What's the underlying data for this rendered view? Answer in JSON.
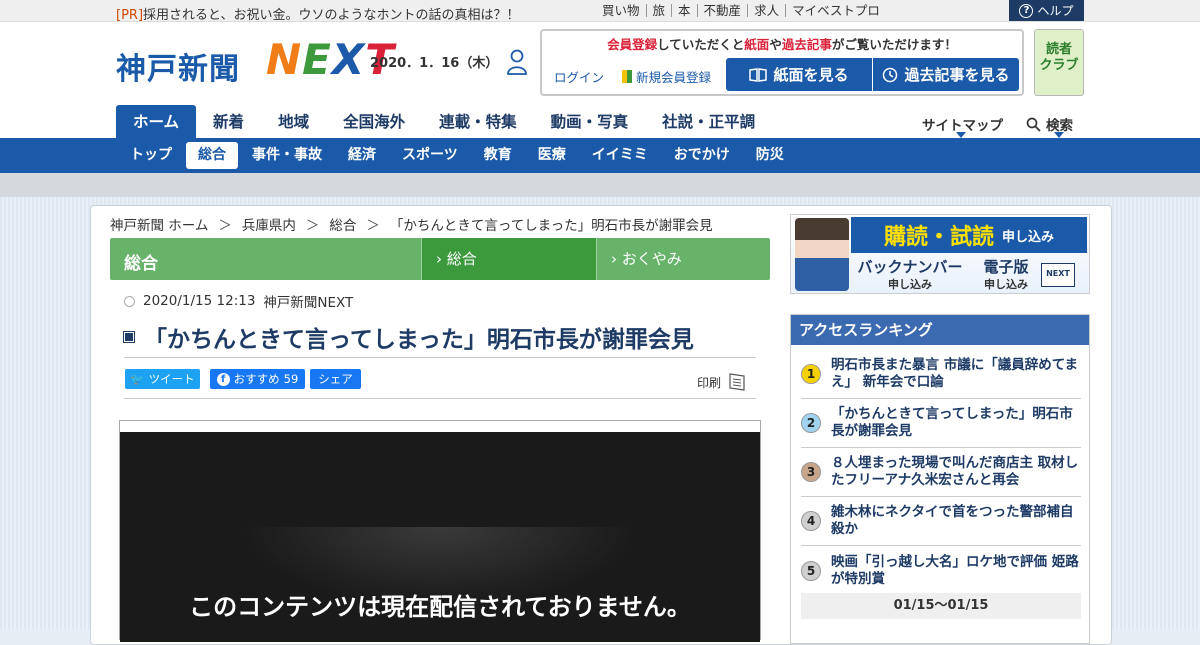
{
  "topbar": {
    "pr_tag": "[PR]",
    "pr_text": "採用されると、お祝い金。ウソのようなホントの話の真相は？！",
    "links": [
      "買い物",
      "旅",
      "本",
      "不動産",
      "求人",
      "マイベストプロ"
    ],
    "help": "ヘルプ"
  },
  "header": {
    "logo_jp": "神戸新聞",
    "logo_next": [
      "N",
      "E",
      "X",
      "T"
    ],
    "date": "2020．1．16（木）",
    "member_msg": {
      "p1": "会員登録",
      "p2": "していただくと",
      "p3": "紙面",
      "p4": "や",
      "p5": "過去記事",
      "p6": "がご覧いただけます！"
    },
    "login": "ログイン",
    "new_register": "新規会員登録",
    "paper_button": "紙面を見る",
    "past_button": "過去記事を見る",
    "reader_club_1": "読者",
    "reader_club_2": "クラブ"
  },
  "mainnav": {
    "items": [
      "ホーム",
      "新着",
      "地域",
      "全国海外",
      "連載・特集",
      "動画・写真",
      "社説・正平調"
    ],
    "sitemap": "サイトマップ",
    "search": "検索"
  },
  "subnav": {
    "items": [
      "トップ",
      "総合",
      "事件・事故",
      "経済",
      "スポーツ",
      "教育",
      "医療",
      "イイミミ",
      "おでかけ",
      "防災"
    ]
  },
  "breadcrumb": [
    "神戸新聞 ホーム",
    "兵庫県内",
    "総合",
    "「かちんときて言ってしまった」明石市長が謝罪会見"
  ],
  "category": {
    "title": "総合",
    "tab1": "総合",
    "tab2": "おくやみ"
  },
  "article": {
    "datetime": "2020/1/15 12:13",
    "source": "神戸新聞NEXT",
    "headline": "「かちんときて言ってしまった」明石市長が謝罪会見",
    "tweet": "ツイート",
    "fb_like": "おすすめ",
    "fb_like_count": "59",
    "fb_share": "シェア",
    "print": "印刷",
    "video_message": "このコンテンツは現在配信されておりません。"
  },
  "ad": {
    "subscribe": "購読・試読",
    "subscribe_small": "申し込み",
    "backnumber": "バックナンバー",
    "backnumber_small": "申し込み",
    "digital": "電子版",
    "digital_small": "申し込み",
    "next_badge": "NEXT"
  },
  "ranking": {
    "title": "アクセスランキング",
    "items": [
      {
        "rank": "1",
        "text": "明石市長また暴言 市議に「議員辞めてまえ」 新年会で口論",
        "color": "#f5d100"
      },
      {
        "rank": "2",
        "text": "「かちんときて言ってしまった」明石市長が謝罪会見",
        "color": "#9fd3f0"
      },
      {
        "rank": "3",
        "text": "８人埋まった現場で叫んだ商店主 取材したフリーアナ久米宏さんと再会",
        "color": "#c7a58a"
      },
      {
        "rank": "4",
        "text": "雑木林にネクタイで首をつった警部補自殺か",
        "color": "#cfcfcf"
      },
      {
        "rank": "5",
        "text": "映画「引っ越し大名」ロケ地で評価 姫路が特別賞",
        "color": "#cfcfcf"
      }
    ],
    "date_range": "01/15～01/15"
  },
  "colors": {
    "brand_blue": "#1b5aa8",
    "navy": "#1e3b66",
    "green": "#68b36a",
    "red": "#d9223a"
  }
}
